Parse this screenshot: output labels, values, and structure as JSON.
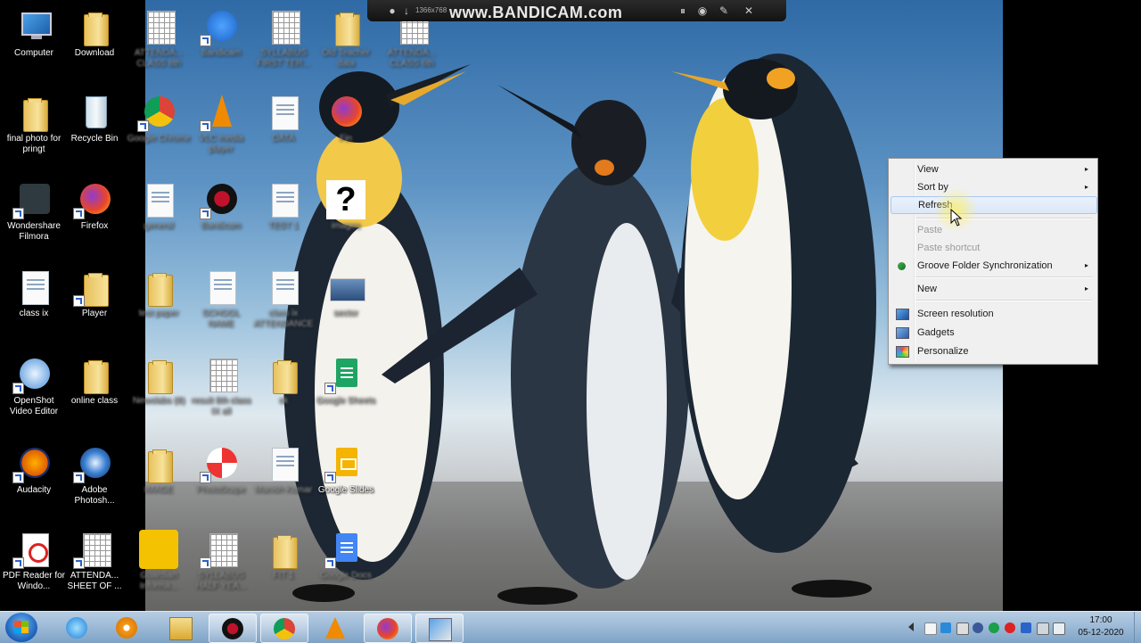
{
  "bandicam": {
    "brand": "www.BANDICAM.com",
    "resolution": "1366x768"
  },
  "desktop": {
    "icons": [
      {
        "label": "Computer"
      },
      {
        "label": "Download"
      },
      {
        "label": "ATTENDA... CLASS 8th"
      },
      {
        "label": "Bandicam"
      },
      {
        "label": "SYLLABUS FIRST TER..."
      },
      {
        "label": "Old Teacher data"
      },
      {
        "label": "ATTENDA... CLASS 6th"
      },
      {
        "label": "final photo for pringt"
      },
      {
        "label": "Recycle Bin"
      },
      {
        "label": "Google Chrome"
      },
      {
        "label": "VLC media player"
      },
      {
        "label": "DATA"
      },
      {
        "label": "Fin"
      },
      {
        "label": "Wondershare Filmora"
      },
      {
        "label": "Firefox"
      },
      {
        "label": "general"
      },
      {
        "label": "Bandicam"
      },
      {
        "label": "TEST 1"
      },
      {
        "label": "images"
      },
      {
        "label": "class ix"
      },
      {
        "label": "Player"
      },
      {
        "label": "test paper"
      },
      {
        "label": "SCHOOL NAME"
      },
      {
        "label": "class ix ATTENDANCE"
      },
      {
        "label": "sector"
      },
      {
        "label": "OpenShot Video Editor"
      },
      {
        "label": "online class"
      },
      {
        "label": "Newslabs (8)"
      },
      {
        "label": "result 8th class IX all"
      },
      {
        "label": "ok"
      },
      {
        "label": "Google Sheets"
      },
      {
        "label": "Audacity"
      },
      {
        "label": "Adobe Photosh..."
      },
      {
        "label": "IMAGE"
      },
      {
        "label": "PhotoScape"
      },
      {
        "label": "Manish Kumar"
      },
      {
        "label": "Google Slides"
      },
      {
        "label": "PDF Reader for Windo..."
      },
      {
        "label": "ATTENDA... SHEET OF ..."
      },
      {
        "label": "Guardian Informa..."
      },
      {
        "label": "SYLLABUS HALF YEA..."
      },
      {
        "label": "FIT 1"
      },
      {
        "label": "Google Docs"
      }
    ]
  },
  "context_menu": {
    "items": [
      {
        "label": "View",
        "arrow": "▸"
      },
      {
        "label": "Sort by",
        "arrow": "▸"
      },
      {
        "label": "Refresh"
      },
      {
        "label": "Paste"
      },
      {
        "label": "Paste shortcut"
      },
      {
        "label": "Groove Folder Synchronization",
        "arrow": "▸"
      },
      {
        "label": "New",
        "arrow": "▸"
      },
      {
        "label": "Screen resolution"
      },
      {
        "label": "Gadgets"
      },
      {
        "label": "Personalize"
      }
    ]
  },
  "taskbar": {
    "pinned": [
      {
        "icon": "internet-explorer-icon"
      },
      {
        "icon": "media-player-icon"
      },
      {
        "icon": "file-explorer-icon"
      },
      {
        "icon": "bandicam-icon"
      },
      {
        "icon": "chrome-icon"
      },
      {
        "icon": "vlc-icon"
      },
      {
        "icon": "firefox-icon"
      },
      {
        "icon": "photoscape-icon"
      }
    ],
    "clock": {
      "time": "17:00",
      "date": "05-12-2020"
    }
  },
  "colors": {
    "taskbar": "#9ebbd8",
    "menu_bg": "#f0f0f0",
    "menu_hover": "#dce8f7",
    "bandicam_bar": "#1b1b1b"
  }
}
